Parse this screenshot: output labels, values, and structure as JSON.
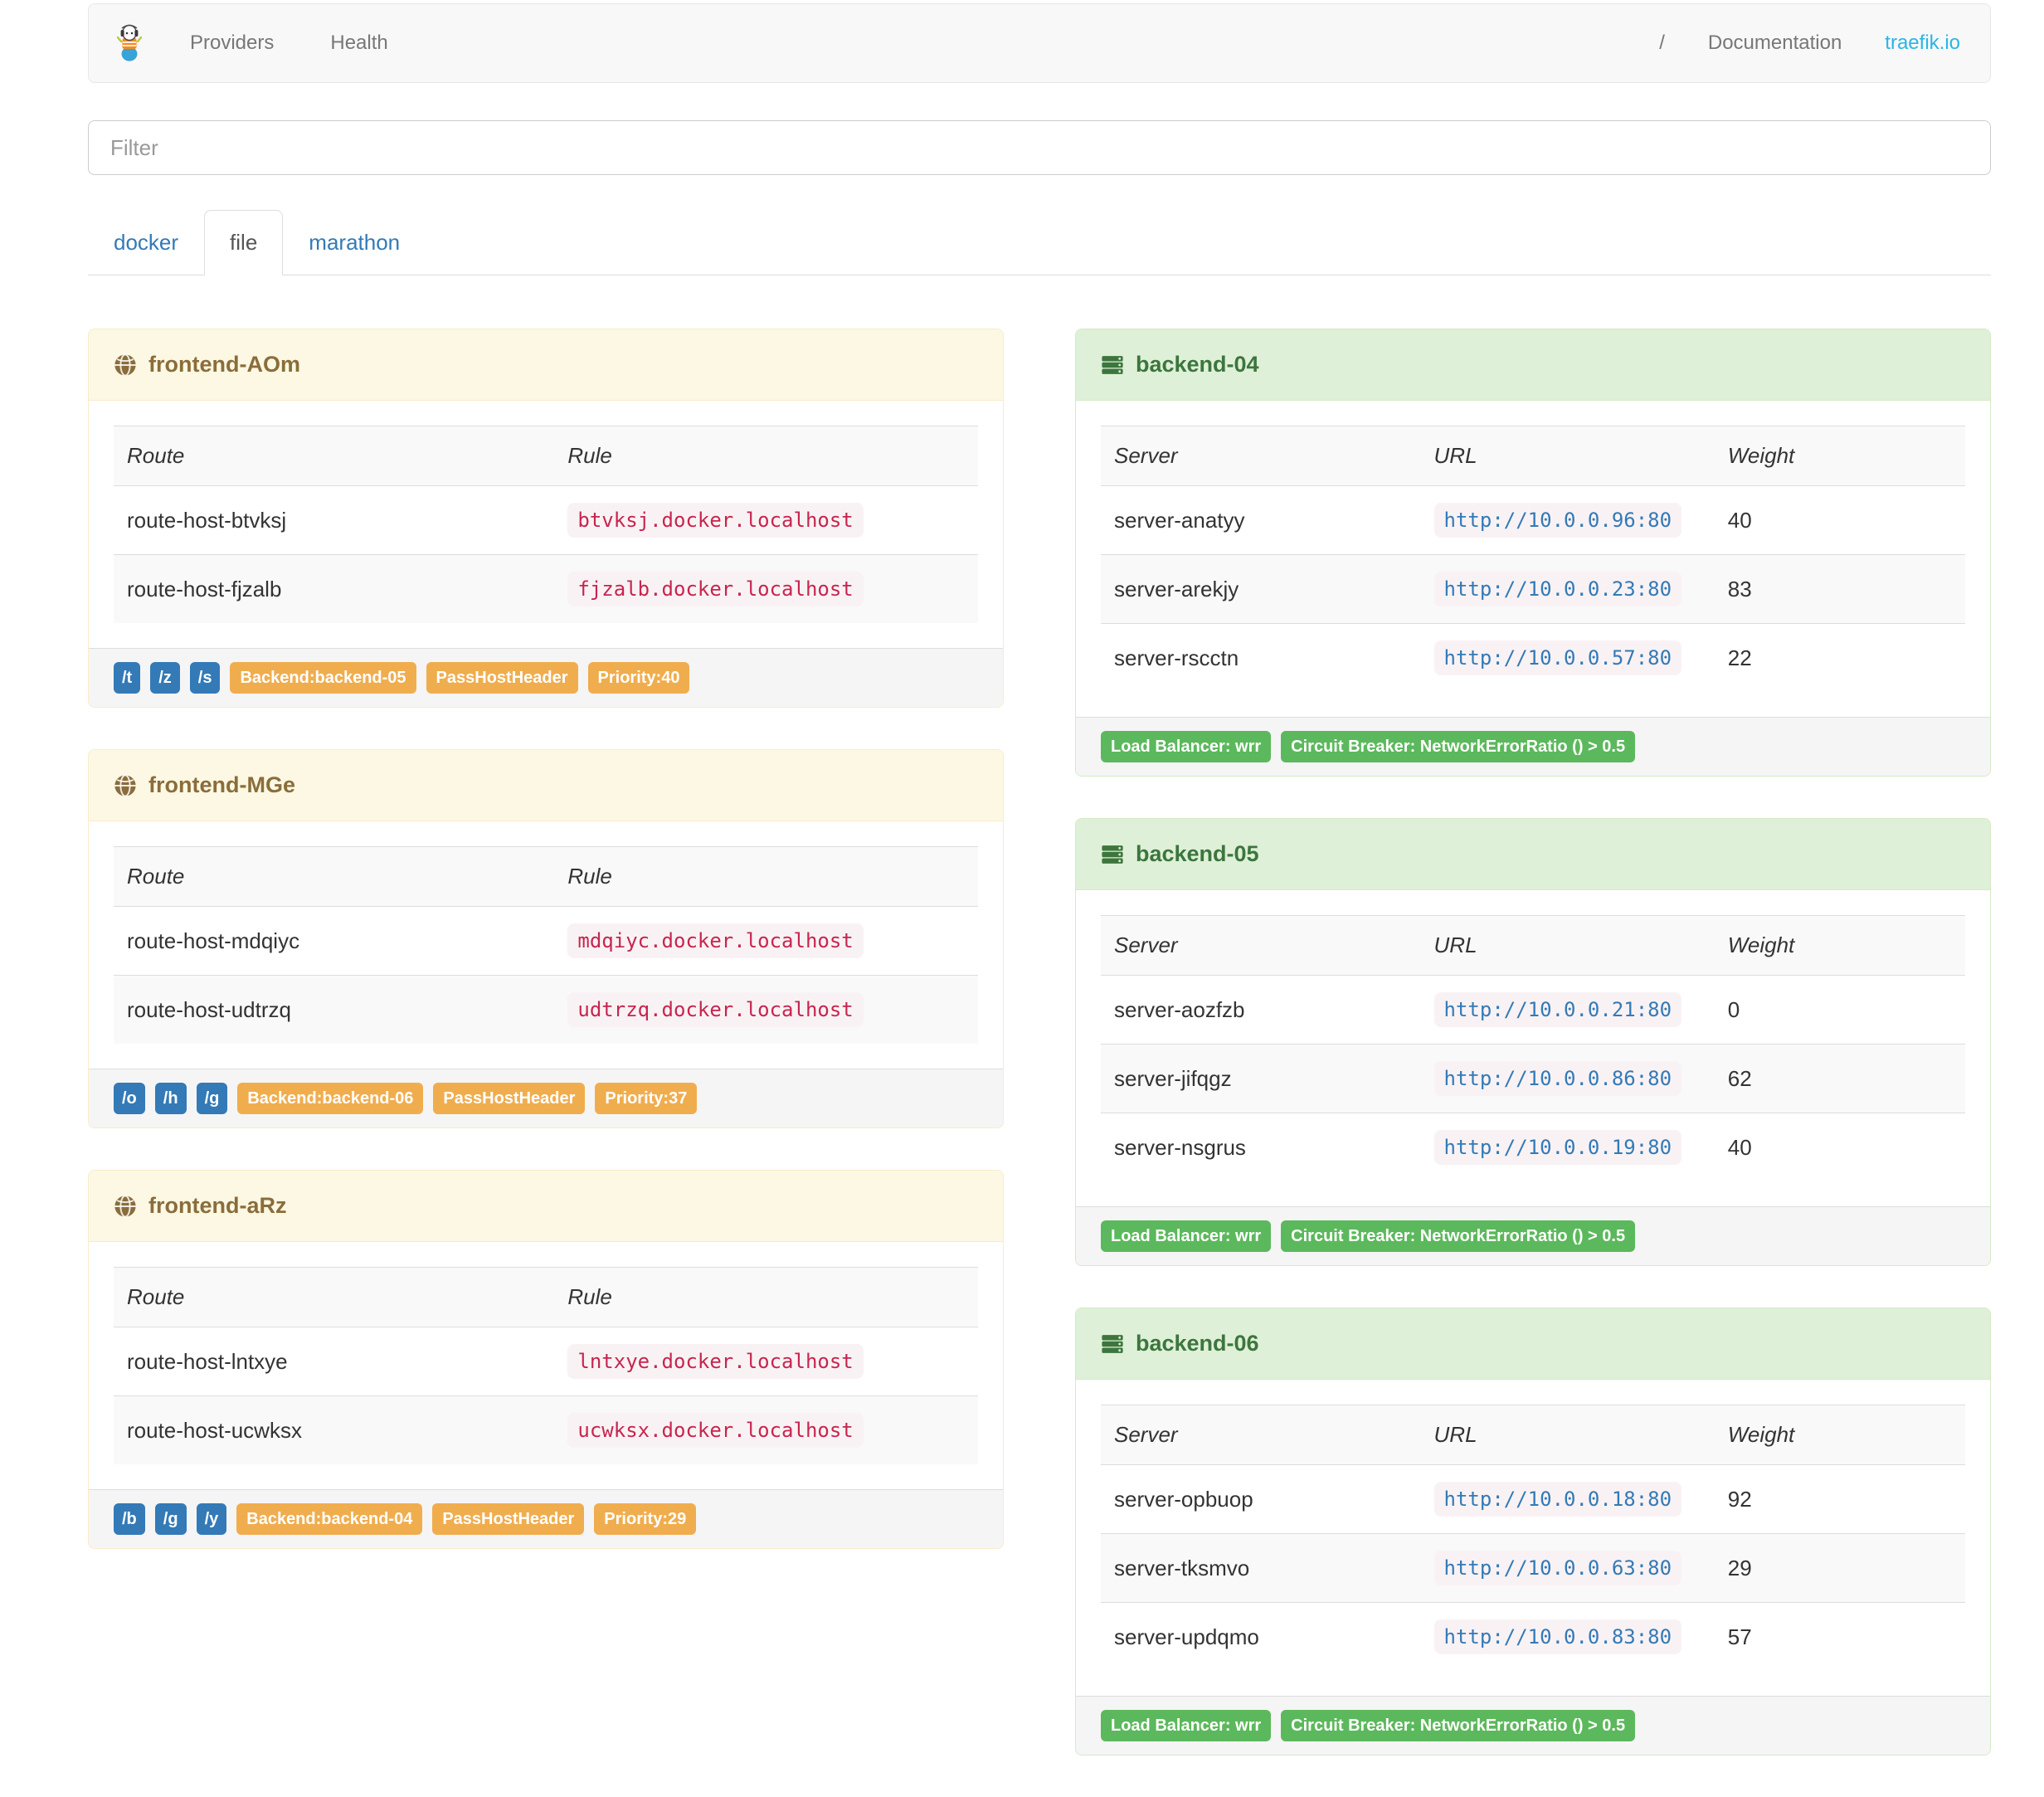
{
  "navbar": {
    "brand": "traefik-logo",
    "items": [
      {
        "label": "Providers"
      },
      {
        "label": "Health"
      }
    ],
    "right_items": [
      {
        "label": "/"
      },
      {
        "label": "Documentation"
      },
      {
        "label": "traefik.io"
      }
    ]
  },
  "filter": {
    "placeholder": "Filter"
  },
  "tabs": [
    {
      "label": "docker",
      "active": false
    },
    {
      "label": "file",
      "active": true
    },
    {
      "label": "marathon",
      "active": false
    }
  ],
  "frontends": [
    {
      "title": "frontend-AOm",
      "columns": [
        "Route",
        "Rule"
      ],
      "routes": [
        {
          "route": "route-host-btvksj",
          "rule": "btvksj.docker.localhost"
        },
        {
          "route": "route-host-fjzalb",
          "rule": "fjzalb.docker.localhost"
        }
      ],
      "path_badges": [
        "/t",
        "/z",
        "/s"
      ],
      "badges": [
        "Backend:backend-05",
        "PassHostHeader",
        "Priority:40"
      ]
    },
    {
      "title": "frontend-MGe",
      "columns": [
        "Route",
        "Rule"
      ],
      "routes": [
        {
          "route": "route-host-mdqiyc",
          "rule": "mdqiyc.docker.localhost"
        },
        {
          "route": "route-host-udtrzq",
          "rule": "udtrzq.docker.localhost"
        }
      ],
      "path_badges": [
        "/o",
        "/h",
        "/g"
      ],
      "badges": [
        "Backend:backend-06",
        "PassHostHeader",
        "Priority:37"
      ]
    },
    {
      "title": "frontend-aRz",
      "columns": [
        "Route",
        "Rule"
      ],
      "routes": [
        {
          "route": "route-host-lntxye",
          "rule": "lntxye.docker.localhost"
        },
        {
          "route": "route-host-ucwksx",
          "rule": "ucwksx.docker.localhost"
        }
      ],
      "path_badges": [
        "/b",
        "/g",
        "/y"
      ],
      "badges": [
        "Backend:backend-04",
        "PassHostHeader",
        "Priority:29"
      ]
    }
  ],
  "backends": [
    {
      "title": "backend-04",
      "columns": [
        "Server",
        "URL",
        "Weight"
      ],
      "servers": [
        {
          "server": "server-anatyy",
          "url": "http://10.0.0.96:80",
          "weight": "40"
        },
        {
          "server": "server-arekjy",
          "url": "http://10.0.0.23:80",
          "weight": "83"
        },
        {
          "server": "server-rscctn",
          "url": "http://10.0.0.57:80",
          "weight": "22"
        }
      ],
      "badges": [
        "Load Balancer: wrr",
        "Circuit Breaker: NetworkErrorRatio () > 0.5"
      ]
    },
    {
      "title": "backend-05",
      "columns": [
        "Server",
        "URL",
        "Weight"
      ],
      "servers": [
        {
          "server": "server-aozfzb",
          "url": "http://10.0.0.21:80",
          "weight": "0"
        },
        {
          "server": "server-jifqgz",
          "url": "http://10.0.0.86:80",
          "weight": "62"
        },
        {
          "server": "server-nsgrus",
          "url": "http://10.0.0.19:80",
          "weight": "40"
        }
      ],
      "badges": [
        "Load Balancer: wrr",
        "Circuit Breaker: NetworkErrorRatio () > 0.5"
      ]
    },
    {
      "title": "backend-06",
      "columns": [
        "Server",
        "URL",
        "Weight"
      ],
      "servers": [
        {
          "server": "server-opbuop",
          "url": "http://10.0.0.18:80",
          "weight": "92"
        },
        {
          "server": "server-tksmvo",
          "url": "http://10.0.0.63:80",
          "weight": "29"
        },
        {
          "server": "server-updqmo",
          "url": "http://10.0.0.83:80",
          "weight": "57"
        }
      ],
      "badges": [
        "Load Balancer: wrr",
        "Circuit Breaker: NetworkErrorRatio () > 0.5"
      ]
    }
  ],
  "colors": {
    "primary_badge": "#337ab7",
    "warning_badge": "#f0ad4e",
    "success_badge": "#5cb85c",
    "frontend_heading_bg": "#fcf8e3",
    "frontend_heading_text": "#8a6d3b",
    "backend_heading_bg": "#dff0d8",
    "backend_heading_text": "#3c763d",
    "rule_text": "#c7254e",
    "url_text": "#337ab7",
    "chip_bg": "#f9f2f4",
    "traefik_link": "#2ab5e5"
  }
}
